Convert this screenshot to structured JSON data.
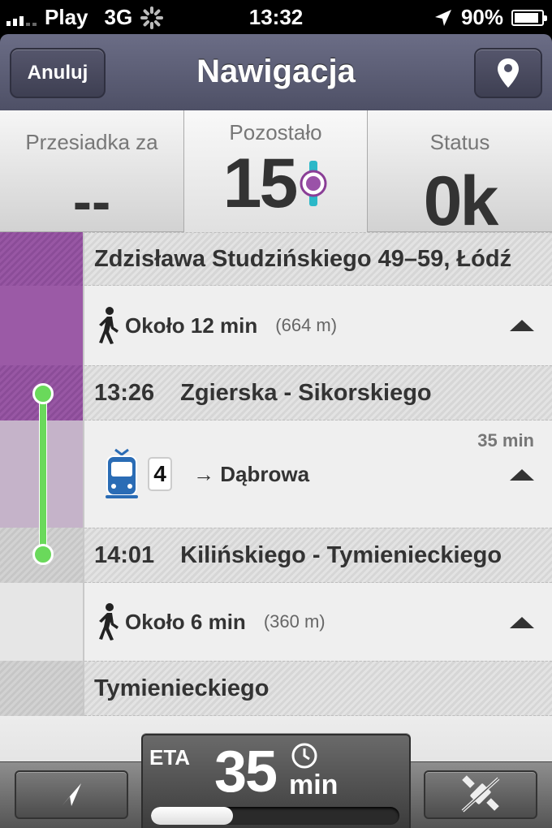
{
  "status_bar": {
    "carrier": "Play",
    "network": "3G",
    "time": "13:32",
    "battery": "90%"
  },
  "nav": {
    "title": "Nawigacja",
    "cancel_label": "Anuluj",
    "pin_icon": "map-pin-icon"
  },
  "info": {
    "transfer_label": "Przesiadka za",
    "transfer_value": "--",
    "remaining_label": "Pozostało",
    "remaining_value": "15",
    "status_label": "Status",
    "status_value": "0k"
  },
  "colors": {
    "walk_lane": "#9b5aa6",
    "tram_lane": "#c5b3c9",
    "route": "#6ad95b",
    "nav": "#5b5d75",
    "tram": "#2a6cb5"
  },
  "itinerary": {
    "start_stop": "Zdzisława Studzińskiego 49–59, Łódź",
    "walk1": {
      "label": "Około 12 min",
      "distance": "(664 m)"
    },
    "stop1": {
      "time": "13:26",
      "name": "Zgierska - Sikorskiego"
    },
    "tram": {
      "line": "4",
      "direction": "→ Dąbrowa",
      "duration": "35 min"
    },
    "stop2": {
      "time": "14:01",
      "name": "Kilińskiego - Tymienieckiego"
    },
    "walk2": {
      "label": "Około 6 min",
      "distance": "(360 m)"
    },
    "end_stop": "Tymienieckiego"
  },
  "eta": {
    "label": "ETA",
    "value": "35",
    "unit": "min",
    "progress": 0.33
  }
}
